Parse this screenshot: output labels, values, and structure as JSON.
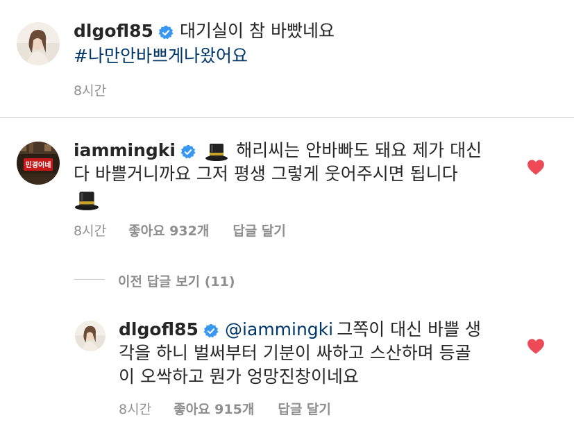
{
  "caption": {
    "username": "dlgofl85",
    "verified": true,
    "text": "대기실이 참 바빴네요",
    "hashtag": "#나만안바쁘게나왔어요",
    "time": "8시간"
  },
  "comment1": {
    "username": "iammingki",
    "verified": true,
    "text_line1": "해리씨는 안바빠도 돼요 제가 대신",
    "text_line2": "다 바쁠거니까요 그저 평생 그렇게 웃어주시면 됩니다",
    "emoji": "tophat",
    "time": "8시간",
    "likes": "좋아요 932개",
    "reply": "답글 달기",
    "liked": true
  },
  "view_previous": "이전 답글 보기 (11)",
  "reply1": {
    "username": "dlgofl85",
    "verified": true,
    "mention": "@iammingki",
    "text_line1": "그쪽이 대신 바쁠 생",
    "text_line2": "각을 하니 벌써부터 기분이 싸하고 스산하며 등골",
    "text_line3": "이 오싹하고 뭔가 엉망진창이네요",
    "time": "8시간",
    "likes": "좋아요 915개",
    "reply": "답글 달기",
    "liked": true
  },
  "colors": {
    "heart": "#ed4956",
    "verified": "#3897f0",
    "link": "#00376b",
    "meta": "#8e8e8e"
  }
}
